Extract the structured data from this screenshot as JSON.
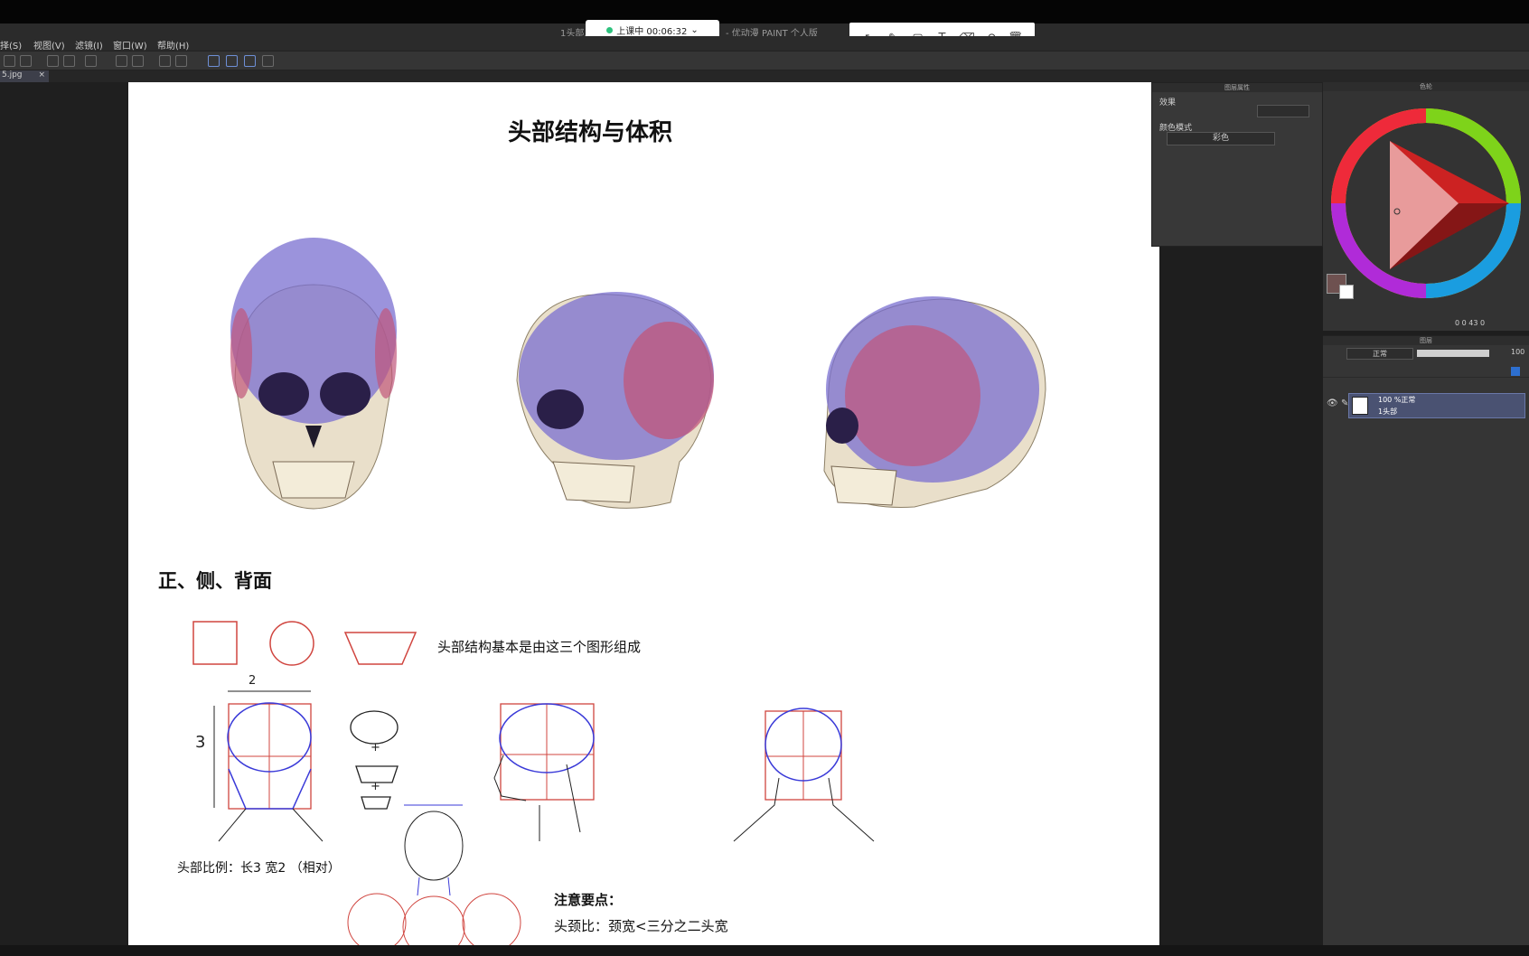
{
  "app": {
    "window_title_left": "1头部...",
    "window_title_right": "- 优动漫 PAINT 个人版"
  },
  "recording": {
    "label": "上课中 00:06:32"
  },
  "menu": [
    "择(S)",
    "视图(V)",
    "滤镜(I)",
    "窗口(W)",
    "帮助(H)"
  ],
  "tab": {
    "label": "5.jpg",
    "close": "×"
  },
  "annotation_tools": [
    "pointer-icon",
    "pen-icon",
    "rectangle-icon",
    "text-icon",
    "eraser-icon",
    "undo-icon",
    "trash-icon"
  ],
  "page": {
    "title": "头部结构与体积",
    "section_title": "正、侧、背面",
    "shapes_caption": "头部结构基本是由这三个图形组成",
    "proportion_caption": "头部比例：长3 宽2 （相对）",
    "dim_width": "2",
    "dim_height": "3",
    "notes_title": "注意要点：",
    "notes_line1": "头颈比：颈宽<三分之二头宽",
    "plus": "+"
  },
  "property_panel": {
    "title": "图层属性",
    "effect_label": "效果",
    "color_mode_label": "颜色模式",
    "color_mode_value": "彩色"
  },
  "color_panel": {
    "title": "色轮",
    "readout": "0  0  43  0"
  },
  "layer_panel": {
    "title": "图层",
    "blend_mode": "正常",
    "opacity": "100",
    "layer_opacity": "100 %正常",
    "layer_name": "1头部"
  },
  "colors": {
    "accent_layer": "#4a5272",
    "skull_purple": "#7a6fd0",
    "skull_pink": "#c0567a",
    "guide_red": "#d0453f",
    "guide_blue": "#3a3ad8"
  }
}
